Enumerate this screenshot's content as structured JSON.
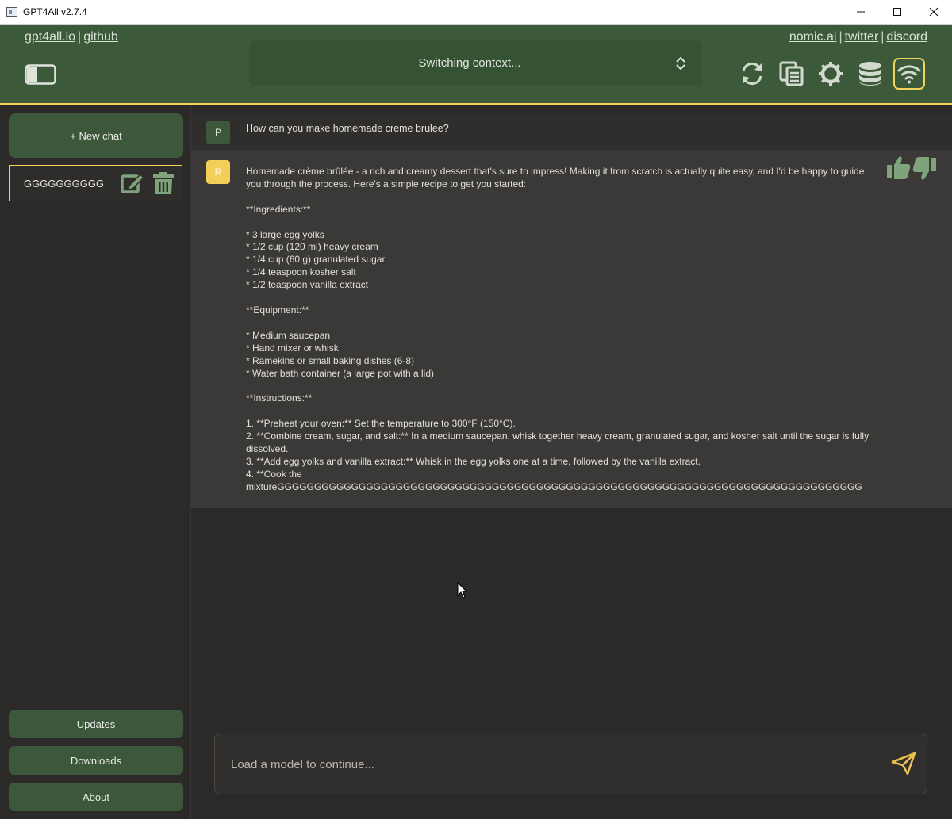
{
  "window": {
    "title": "GPT4All v2.7.4"
  },
  "header": {
    "links_left": [
      "gpt4all.io",
      "github"
    ],
    "links_right": [
      "nomic.ai",
      "twitter",
      "discord"
    ],
    "separator": "|",
    "model_select": {
      "label": "Switching context..."
    },
    "icons": [
      "reset-context-icon",
      "copy-conversation-icon",
      "settings-icon",
      "database-icon",
      "network-icon"
    ]
  },
  "sidebar": {
    "new_chat_label": "+ New chat",
    "chat_item_name": "GGGGGGGGGGG...",
    "updates_label": "Updates",
    "downloads_label": "Downloads",
    "about_label": "About"
  },
  "conversation": {
    "prompt": {
      "avatar": "P",
      "text": "How can you make homemade creme brulee?"
    },
    "response": {
      "avatar": "R",
      "text": "Homemade crème brûlée - a rich and creamy dessert that's sure to impress! Making it from scratch is actually quite easy, and I'd be happy to guide you through the process. Here's a simple recipe to get you started:\n\n**Ingredients:**\n\n* 3 large egg yolks\n* 1/2 cup (120 ml) heavy cream\n* 1/4 cup (60 g) granulated sugar\n* 1/4 teaspoon kosher salt\n* 1/2 teaspoon vanilla extract\n\n**Equipment:**\n\n* Medium saucepan\n* Hand mixer or whisk\n* Ramekins or small baking dishes (6-8)\n* Water bath container (a large pot with a lid)\n\n**Instructions:**\n\n1. **Preheat your oven:** Set the temperature to 300°F (150°C).\n2. **Combine cream, sugar, and salt:** In a medium saucepan, whisk together heavy cream, granulated sugar, and kosher salt until the sugar is fully dissolved.\n3. **Add egg yolks and vanilla extract:** Whisk in the egg yolks one at a time, followed by the vanilla extract.\n4. **Cook the\nmixtureGGGGGGGGGGGGGGGGGGGGGGGGGGGGGGGGGGGGGGGGGGGGGGGGGGGGGGGGGGGGGGGGGGGGGGGGGGGGGGG"
    }
  },
  "input": {
    "placeholder": "Load a model to continue...",
    "value": ""
  },
  "colors": {
    "header_bg": "#3c5a3a",
    "accent_yellow": "#f0d35b",
    "button_green": "#3d573a",
    "icon_green": "#7fa37a",
    "background": "#2c2a28"
  }
}
